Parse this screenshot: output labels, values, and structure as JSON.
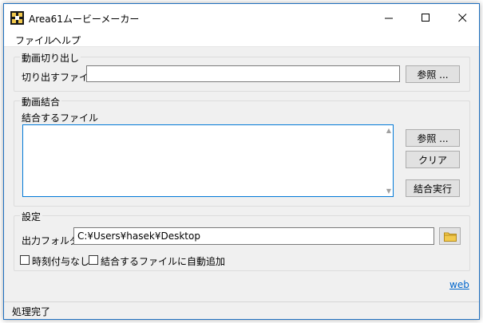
{
  "window": {
    "title": "Area61ムービーメーカー",
    "controls": {
      "minimize": "—",
      "maximize": "☐",
      "close": "✕"
    }
  },
  "menu": {
    "items": [
      "ファイル",
      "ヘルプ"
    ]
  },
  "cut": {
    "group_title": "動画切り出し",
    "file_label": "切り出すファイル",
    "file_value": "",
    "browse_label": "参照 ..."
  },
  "join": {
    "group_title": "動画結合",
    "files_label": "結合するファイル",
    "browse_label": "参照 ...",
    "clear_label": "クリア",
    "run_label": "結合実行"
  },
  "settings": {
    "group_title": "設定",
    "output_label": "出力フォルダ",
    "output_value": "C:¥Users¥hasek¥Desktop",
    "no_timestamp_label": "時刻付与なし",
    "no_timestamp_checked": false,
    "auto_add_label": "結合するファイルに自動追加",
    "auto_add_checked": false
  },
  "footer": {
    "web_link": "web"
  },
  "status": {
    "text": "処理完了"
  },
  "colors": {
    "accent": "#0078d7",
    "link": "#0066cc",
    "folder": "#f2c94c"
  },
  "icons": {
    "app": "app-logo-icon",
    "folder": "folder-icon"
  }
}
